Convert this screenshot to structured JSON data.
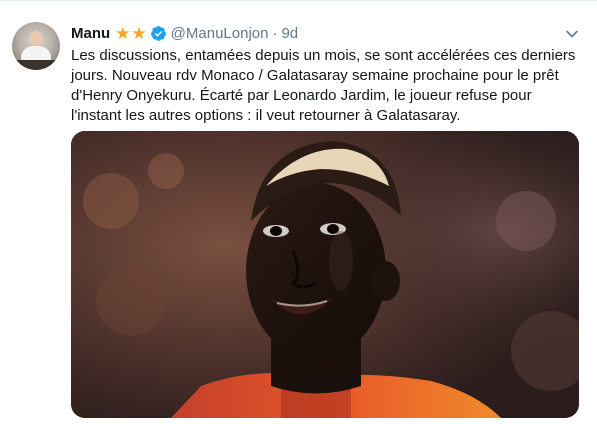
{
  "tweet": {
    "display_name": "Manu",
    "stars": [
      "★",
      "★"
    ],
    "handle": "@ManuLonjon",
    "separator": "·",
    "time": "9d",
    "text": "Les discussions, entamées depuis un mois, se sont accélérées ces derniers jours. Nouveau rdv Monaco / Galatasaray semaine prochaine pour le prêt d'Henry Onyekuru. Écarté par Leonardo Jardim, le joueur refuse pour l'instant les autres options : il veut retourner à Galatasaray."
  },
  "colors": {
    "verified_badge": "#1da1f2",
    "stars": "#f5a623",
    "text": "#14171a",
    "secondary_text": "#657786",
    "jersey": "#e8572a"
  },
  "icons": {
    "verified": "verified-badge-icon",
    "star": "star-icon",
    "caret": "chevron-down-icon"
  }
}
